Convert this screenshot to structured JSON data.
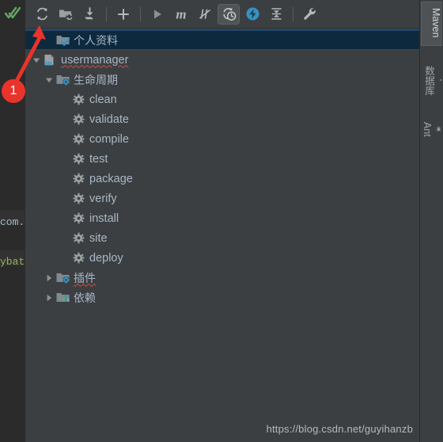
{
  "window": {
    "title": "Maven",
    "watermark": "https://blog.csdn.net/guyihanzb"
  },
  "editor_sliver": {
    "check_icon": "double-check-icon",
    "code_fragments": [
      "com.",
      "ybat"
    ]
  },
  "toolbar": {
    "buttons": [
      {
        "id": "reimport",
        "name": "reimport-all-maven-projects-button",
        "icon": "refresh-icon",
        "tooltip": "Reimport All Maven Projects",
        "active": false
      },
      {
        "id": "generate-sources",
        "name": "generate-sources-button",
        "icon": "folder-refresh-icon",
        "tooltip": "Generate Sources and Update Folders",
        "active": false
      },
      {
        "id": "download-sources",
        "name": "download-sources-button",
        "icon": "download-icon",
        "tooltip": "Download Sources and/or Documentation",
        "active": false
      },
      {
        "id": "add",
        "name": "add-maven-project-button",
        "icon": "plus-icon",
        "tooltip": "Add Maven Projects",
        "active": false
      },
      {
        "id": "run",
        "name": "run-maven-build-button",
        "icon": "play-icon",
        "tooltip": "Run Maven Build",
        "active": false
      },
      {
        "id": "execute-goal",
        "name": "execute-maven-goal-button",
        "icon": "m-icon",
        "tooltip": "Execute Maven Goal",
        "active": false
      },
      {
        "id": "toggle-skip",
        "name": "toggle-skip-tests-button",
        "icon": "skip-tests-icon",
        "tooltip": "Toggle 'Skip Tests' Mode",
        "active": false
      },
      {
        "id": "toggle-offline",
        "name": "toggle-offline-mode-button",
        "icon": "offline-mode-icon",
        "tooltip": "Toggle Offline Mode",
        "active": true
      },
      {
        "id": "show-diagram",
        "name": "show-dependencies-button",
        "icon": "lightning-icon",
        "tooltip": "Show Dependencies",
        "active": false
      },
      {
        "id": "collapse",
        "name": "collapse-all-button",
        "icon": "collapse-all-icon",
        "tooltip": "Collapse All",
        "active": false
      },
      {
        "id": "settings",
        "name": "maven-settings-button",
        "icon": "wrench-icon",
        "tooltip": "Maven Settings",
        "active": false
      }
    ],
    "separators_after": [
      "download-sources",
      "add",
      "collapse"
    ]
  },
  "tree": {
    "nodes": [
      {
        "id": "profiles",
        "label": "个人资料",
        "icon": "folder-check-icon",
        "indent": 1,
        "twisty": "none",
        "selected": true,
        "squiggle": false,
        "cjk": true
      },
      {
        "id": "usermanager",
        "label": "usermanager",
        "icon": "maven-module-icon",
        "indent": 0,
        "twisty": "expanded",
        "selected": false,
        "squiggle": true,
        "cjk": false
      },
      {
        "id": "lifecycle",
        "label": "生命周期",
        "icon": "folder-gear-icon",
        "indent": 1,
        "twisty": "expanded",
        "selected": false,
        "squiggle": false,
        "cjk": true
      },
      {
        "id": "clean",
        "label": "clean",
        "icon": "goal-gear-icon",
        "indent": 2,
        "twisty": "none",
        "selected": false,
        "squiggle": false,
        "cjk": false
      },
      {
        "id": "validate",
        "label": "validate",
        "icon": "goal-gear-icon",
        "indent": 2,
        "twisty": "none",
        "selected": false,
        "squiggle": false,
        "cjk": false
      },
      {
        "id": "compile",
        "label": "compile",
        "icon": "goal-gear-icon",
        "indent": 2,
        "twisty": "none",
        "selected": false,
        "squiggle": false,
        "cjk": false
      },
      {
        "id": "test",
        "label": "test",
        "icon": "goal-gear-icon",
        "indent": 2,
        "twisty": "none",
        "selected": false,
        "squiggle": false,
        "cjk": false
      },
      {
        "id": "package",
        "label": "package",
        "icon": "goal-gear-icon",
        "indent": 2,
        "twisty": "none",
        "selected": false,
        "squiggle": false,
        "cjk": false
      },
      {
        "id": "verify",
        "label": "verify",
        "icon": "goal-gear-icon",
        "indent": 2,
        "twisty": "none",
        "selected": false,
        "squiggle": false,
        "cjk": false
      },
      {
        "id": "install",
        "label": "install",
        "icon": "goal-gear-icon",
        "indent": 2,
        "twisty": "none",
        "selected": false,
        "squiggle": false,
        "cjk": false
      },
      {
        "id": "site",
        "label": "site",
        "icon": "goal-gear-icon",
        "indent": 2,
        "twisty": "none",
        "selected": false,
        "squiggle": false,
        "cjk": false
      },
      {
        "id": "deploy",
        "label": "deploy",
        "icon": "goal-gear-icon",
        "indent": 2,
        "twisty": "none",
        "selected": false,
        "squiggle": false,
        "cjk": false
      },
      {
        "id": "plugins",
        "label": "插件",
        "icon": "folder-gear-icon",
        "indent": 1,
        "twisty": "collapsed",
        "selected": false,
        "squiggle": true,
        "cjk": true
      },
      {
        "id": "dependencies",
        "label": "依赖",
        "icon": "folder-bars-icon",
        "indent": 1,
        "twisty": "collapsed",
        "selected": false,
        "squiggle": false,
        "cjk": true
      }
    ]
  },
  "right_bar": {
    "tabs": [
      {
        "id": "maven",
        "label": "Maven",
        "icon": null,
        "active": true
      },
      {
        "id": "database",
        "label": "数据库",
        "icon": "database-icon",
        "active": false
      },
      {
        "id": "ant",
        "label": "Ant",
        "icon": "bug-icon",
        "active": false
      }
    ]
  },
  "annotation": {
    "badge_label": "1",
    "badge_color": "#e8342a",
    "arrow_target": "reimport-all-maven-projects-button"
  }
}
